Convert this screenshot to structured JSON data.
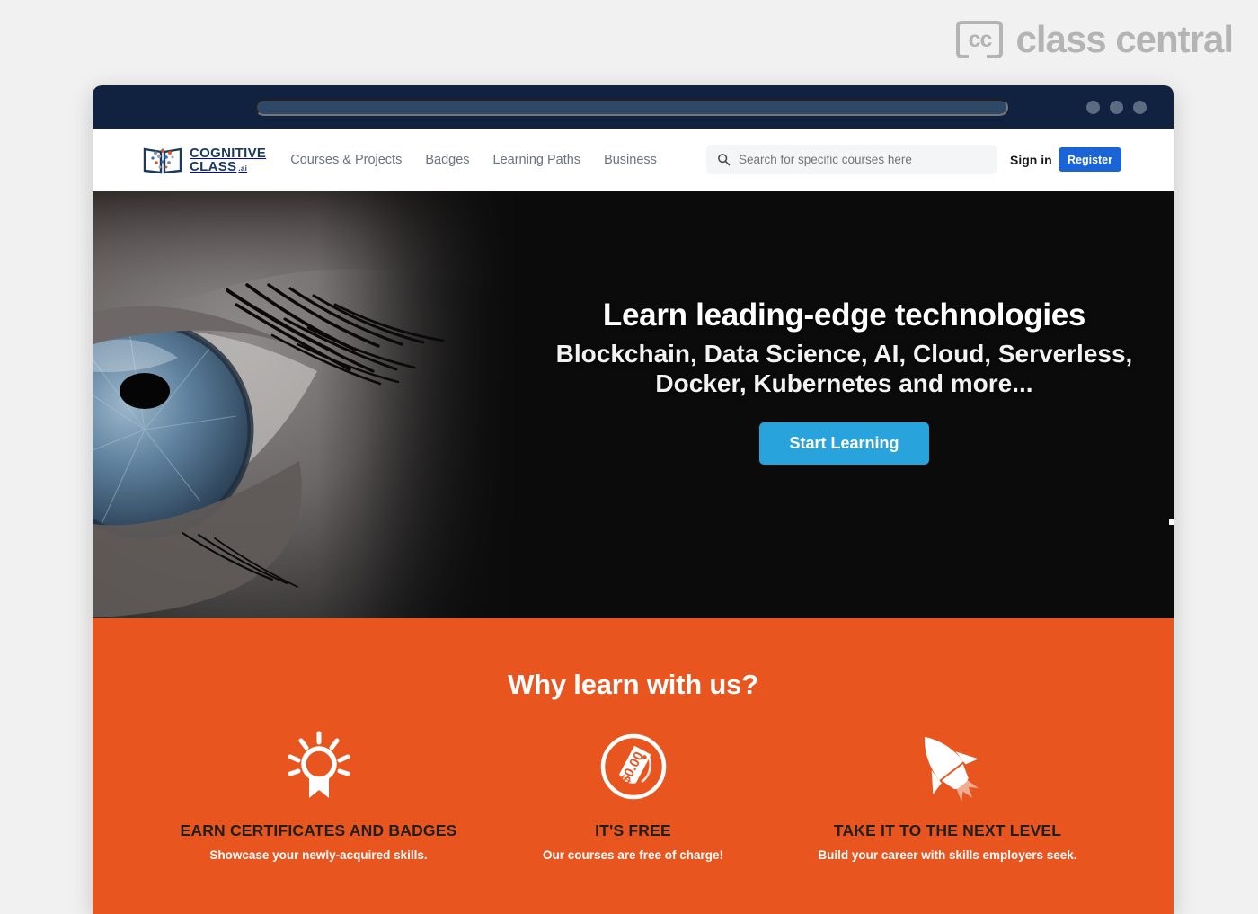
{
  "watermark": {
    "badge": "cc",
    "word": "class central"
  },
  "browser": {
    "url_value": "",
    "url_placeholder": "",
    "window_dots": [
      "minimize-dot",
      "maximize-dot",
      "close-dot"
    ]
  },
  "site_header": {
    "logo": {
      "line1": "COGNITIVE",
      "line2": "CLASS",
      "suffix": ".ai",
      "icon": "open-book-network-icon"
    },
    "nav": [
      {
        "label": "Courses & Projects"
      },
      {
        "label": "Badges"
      },
      {
        "label": "Learning Paths"
      },
      {
        "label": "Business"
      }
    ],
    "search": {
      "placeholder": "Search for specific courses here",
      "value": "",
      "icon": "search-icon"
    },
    "sign_in_label": "Sign in",
    "register_label": "Register"
  },
  "hero": {
    "image": "close-up-blue-eye-photo",
    "headline": "Learn leading-edge technologies",
    "subheadline_line1": "Blockchain, Data Science, AI, Cloud, Serverless,",
    "subheadline_line2": "Docker, Kubernetes and more...",
    "cta_label": "Start Learning"
  },
  "why_section": {
    "heading": "Why learn with us?",
    "cards": [
      {
        "icon": "award-badge-icon",
        "title": "EARN CERTIFICATES AND BADGES",
        "subtitle": "Showcase your newly-acquired skills."
      },
      {
        "icon": "price-tag-icon",
        "tag_text": "$0.00",
        "title": "IT'S FREE",
        "subtitle": "Our courses are free of charge!"
      },
      {
        "icon": "rocket-icon",
        "title": "TAKE IT TO THE NEXT LEVEL",
        "subtitle": "Build your career with skills employers seek."
      }
    ]
  },
  "colors": {
    "orange": "#e9551f",
    "cta_blue": "#29a3dc",
    "register_blue": "#1a64d6",
    "titlebar_navy": "#112240",
    "logo_navy": "#1b3a5c",
    "page_bg": "#f1f1f1"
  }
}
